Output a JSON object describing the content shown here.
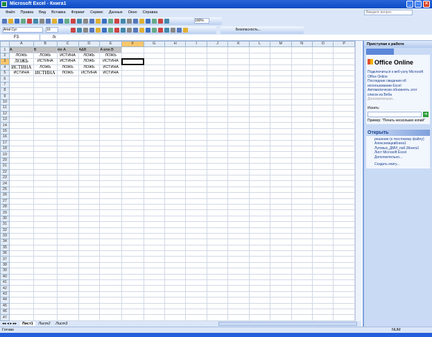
{
  "window": {
    "title": "Microsoft Excel - Книга1"
  },
  "menu": [
    "Файл",
    "Правка",
    "Вид",
    "Вставка",
    "Формат",
    "Сервис",
    "Данные",
    "Окно",
    "Справка"
  ],
  "help_placeholder": "Введите вопрос",
  "toolbar": {
    "zoom": "100%",
    "font": "Arial Cyr",
    "size": "10",
    "security": "Безопасность..."
  },
  "formula_bar": {
    "name_box": "F3",
    "fx": "fx",
    "value": ""
  },
  "columns": [
    "A",
    "B",
    "C",
    "D",
    "E",
    "F",
    "G",
    "H",
    "I",
    "J",
    "K",
    "L",
    "M",
    "N",
    "O",
    "P"
  ],
  "cells": [
    [
      "A",
      "B",
      "Не A",
      "A&B",
      "A или B"
    ],
    [
      "ЛОЖЬ",
      "ЛОЖЬ",
      "ИСТИНА",
      "ЛОЖЬ",
      "ЛОЖЬ"
    ],
    [
      "ЛОЖЬ",
      "ИСТИНА",
      "ИСТИНА",
      "ЛОЖЬ",
      "ИСТИНА"
    ],
    [
      "ИСТИНА",
      "ЛОЖЬ",
      "ЛОЖЬ",
      "ЛОЖЬ",
      "ИСТИНА"
    ],
    [
      "ИСТИНА",
      "ИСТИНА",
      "ЛОЖЬ",
      "ИСТИНА",
      "ИСТИНА"
    ]
  ],
  "row_count": 47,
  "task_pane": {
    "title": "Приступая к работе",
    "logo": "Office Online",
    "links": [
      "Подключиться к веб-узлу Microsoft Office Online",
      "Последние сведения об использовании Excel",
      "Автоматически обновлять этот список из Веба"
    ],
    "more": "Дополнительно...",
    "search_label": "Искать:",
    "example": "Пример: \"Печать нескольких копий\"",
    "open_title": "Открыть",
    "files": [
      "решение (к текстовому файлу)",
      "АлексеевцевКнига1",
      "Луговых_ДМИ_лаб.3Книга1",
      "Лист Microsoft Excel"
    ],
    "open_more": "Дополнительно...",
    "create": "Создать книгу..."
  },
  "sheets": [
    "Лист1",
    "Лист2",
    "Лист3"
  ],
  "status": {
    "ready": "Готово",
    "num": "NUM"
  }
}
